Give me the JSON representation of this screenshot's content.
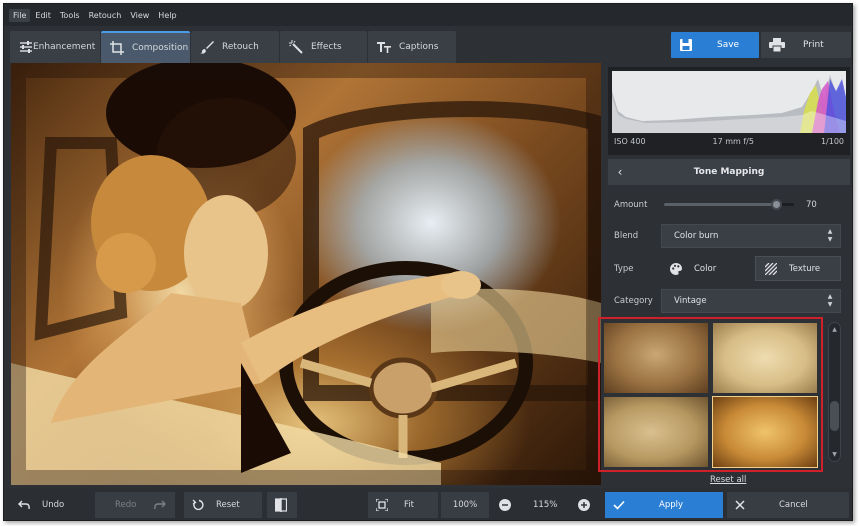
{
  "menu": [
    "File",
    "Edit",
    "Tools",
    "Retouch",
    "View",
    "Help"
  ],
  "tabs": [
    {
      "label": "Enhancement",
      "icon": "sliders-icon",
      "active": false
    },
    {
      "label": "Composition",
      "icon": "crop-icon",
      "active": true
    },
    {
      "label": "Retouch",
      "icon": "brush-icon",
      "active": false
    },
    {
      "label": "Effects",
      "icon": "magic-wand-icon",
      "active": false
    },
    {
      "label": "Captions",
      "icon": "text-icon",
      "active": false
    }
  ],
  "save_label": "Save",
  "print_label": "Print",
  "histogram": {
    "iso": "ISO 400",
    "focal": "17 mm f/5",
    "shutter": "1/100"
  },
  "panel": {
    "title": "Tone Mapping",
    "amount_label": "Amount",
    "amount_value": "70",
    "amount_fraction": 0.86,
    "blend_label": "Blend",
    "blend_value": "Color burn",
    "type_label": "Type",
    "type_color": "Color",
    "type_texture": "Texture",
    "category_label": "Category",
    "category_value": "Vintage",
    "reset_all": "Reset all"
  },
  "bottom": {
    "undo": "Undo",
    "redo": "Redo",
    "reset": "Reset",
    "fit": "Fit",
    "zoom_100": "100%",
    "zoom_current": "115%",
    "apply": "Apply",
    "cancel": "Cancel"
  },
  "colors": {
    "accent": "#2a7fd4",
    "highlight": "#d0202a"
  }
}
